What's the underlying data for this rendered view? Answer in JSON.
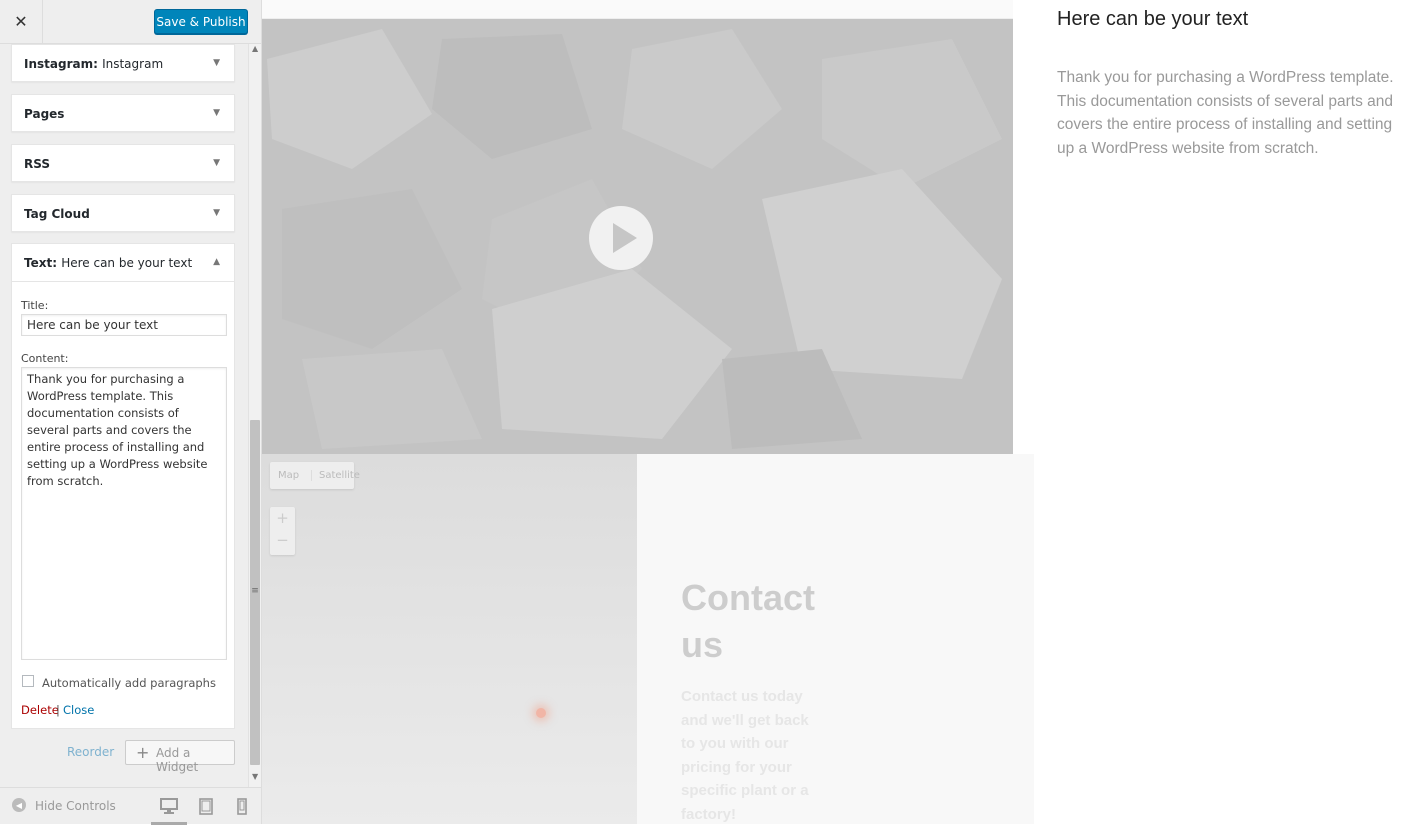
{
  "topbar": {
    "close_icon": "close-icon",
    "publish_label": "Save & Publish",
    "accent": "#0085ba"
  },
  "widgets": [
    {
      "name": "Instagram",
      "sub": "Instagram"
    },
    {
      "name": "Pages",
      "sub": ""
    },
    {
      "name": "RSS",
      "sub": ""
    },
    {
      "name": "Tag Cloud",
      "sub": ""
    }
  ],
  "text_widget": {
    "name": "Text",
    "sub": "Here can be your text",
    "title_label": "Title:",
    "title_value": "Here can be your text",
    "content_label": "Content:",
    "content_value": "Thank you for purchasing a WordPress template. This documentation consists of several parts and covers the entire process of installing and setting up a WordPress website from scratch.",
    "auto_paragraph_label": "Automatically add paragraphs",
    "auto_paragraph_checked": false,
    "delete_label": "Delete",
    "separator": "|",
    "close_label": "Close"
  },
  "actions": {
    "reorder_label": "Reorder",
    "add_widget_label": "Add a Widget"
  },
  "footer": {
    "hide_controls_label": "Hide Controls",
    "devices": [
      "desktop-icon",
      "tablet-icon",
      "mobile-icon"
    ],
    "active_device": "desktop"
  },
  "preview": {
    "map_button": "Map",
    "satellite_button": "Satellite",
    "zoom_in": "+",
    "zoom_out": "−",
    "contact_title": "Contact us",
    "contact_text": "Contact us today and we'll get back to you with our pricing for your specific plant or a factory!",
    "widget_title": "Here can be your text",
    "widget_text": "Thank you for purchasing a WordPress template. This documentation consists of several parts and covers the entire process of installing and setting up a WordPress website from scratch."
  }
}
